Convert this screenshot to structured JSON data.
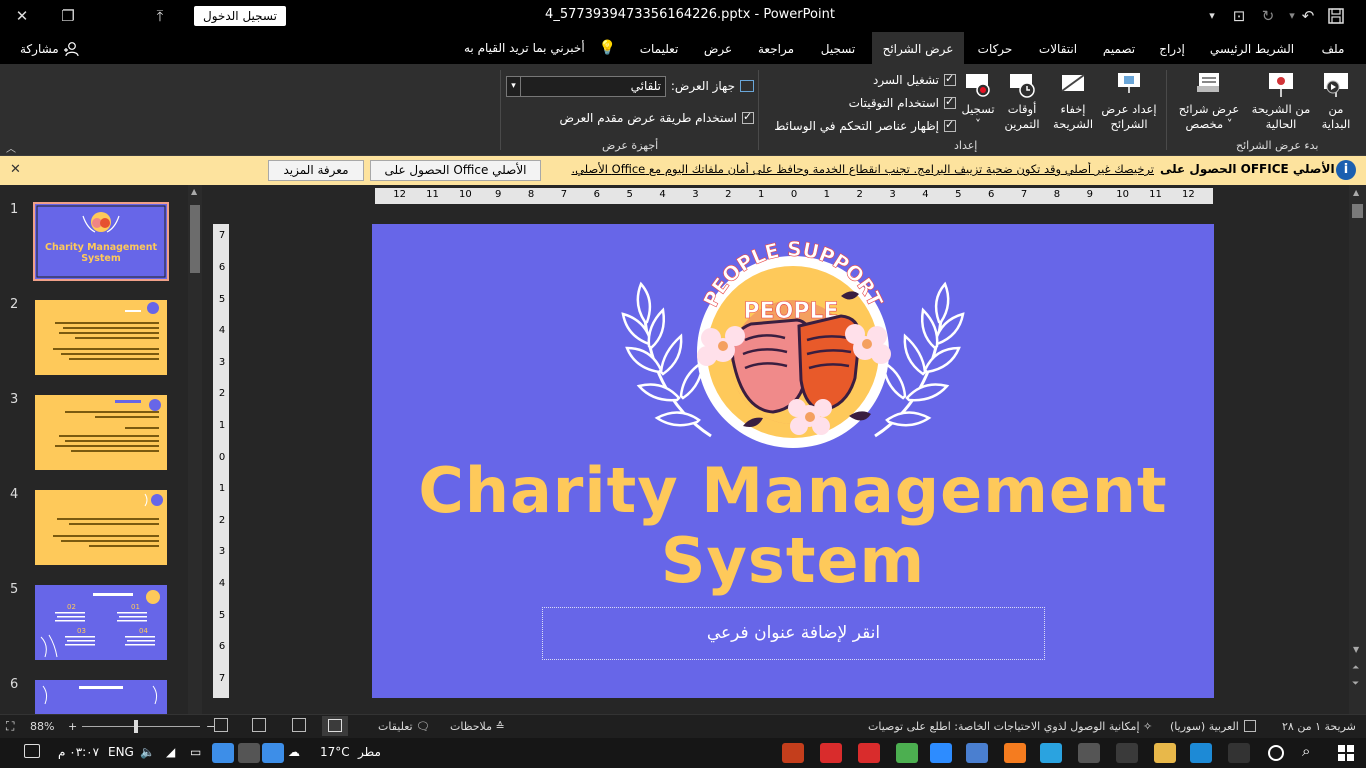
{
  "titlebar": {
    "doc_title": "4_5773939473356164226.pptx  -  PowerPoint",
    "signin_label": "تسجيل الدخول"
  },
  "tabs": {
    "file": "ملف",
    "home": "الشريط الرئيسي",
    "insert": "إدراج",
    "design": "تصميم",
    "transitions": "انتقالات",
    "animations": "حركات",
    "slideshow": "عرض الشرائح",
    "record": "تسجيل",
    "review": "مراجعة",
    "view": "عرض",
    "help": "تعليمات",
    "tell_me": "أخبرني بما تريد القيام به",
    "share": "مشاركة"
  },
  "ribbon": {
    "from_beginning": [
      "من",
      "البداية"
    ],
    "from_current": [
      "من الشريحة",
      "الحالية"
    ],
    "custom_show": [
      "عرض شرائح",
      "مخصص ˅"
    ],
    "group_start": "بدء عرض الشرائح",
    "setup_show": [
      "إعداد عرض",
      "الشرائح"
    ],
    "hide_slide": [
      "إخفاء",
      "الشريحة"
    ],
    "rehearse": [
      "أوقات",
      "التمرين"
    ],
    "record": [
      "تسجيل",
      "˅"
    ],
    "play_narrations": "تشغيل السرد",
    "use_timings": "استخدام التوقيتات",
    "show_media_controls": "إظهار عناصر التحكم في الوسائط",
    "group_setup": "إعداد",
    "monitor_label": "جهاز العرض:",
    "monitor_value": "تلقائي",
    "presenter_view": "استخدام طريقة عرض مقدم العرض",
    "group_monitors": "أجهزة عرض"
  },
  "warning": {
    "title": "الحصول على OFFICE الأصلي",
    "message": "ترخيصك غير أصلي وقد تكون ضحية تزييف البرامج. تجنب انقطاع الخدمة وحافظ على أمان ملفاتك اليوم مع Office الأصلي.",
    "get_genuine": "الحصول على Office الأصلي",
    "learn_more": "معرفة المزيد"
  },
  "thumbnails": {
    "numbers": [
      "1",
      "2",
      "3",
      "4",
      "5",
      "6"
    ],
    "slide1_title_line1": "Charity Management",
    "slide1_title_line2": "System"
  },
  "rulers": {
    "horizontal": [
      "12",
      "11",
      "10",
      "9",
      "8",
      "7",
      "6",
      "5",
      "4",
      "3",
      "2",
      "1",
      "0",
      "1",
      "2",
      "3",
      "4",
      "5",
      "6",
      "7",
      "8",
      "9",
      "10",
      "11",
      "12"
    ],
    "vertical": [
      "7",
      "6",
      "5",
      "4",
      "3",
      "2",
      "1",
      "0",
      "1",
      "2",
      "3",
      "4",
      "5",
      "6",
      "7"
    ]
  },
  "slide": {
    "logo_arc_text": "PEOPLE SUPPORT",
    "logo_text": "PEOPLE",
    "title_line1": "Charity Management",
    "title_line2": "System",
    "subtitle_placeholder": "انقر لإضافة عنوان فرعي",
    "background_color": "#6766e8",
    "title_color": "#fec95a"
  },
  "statusbar": {
    "slide_counter": "شريحة ١ من ٢٨",
    "language": "العربية (سوريا)",
    "accessibility": "إمكانية الوصول لذوي الاحتياجات الخاصة: اطلع على توصيات",
    "notes": "ملاحظات",
    "comments": "تعليقات",
    "zoom": "88%"
  },
  "taskbar": {
    "weather_text": "مطر",
    "temperature": "17°C",
    "language": "ENG",
    "time": "٠٣:٠٧ م"
  }
}
